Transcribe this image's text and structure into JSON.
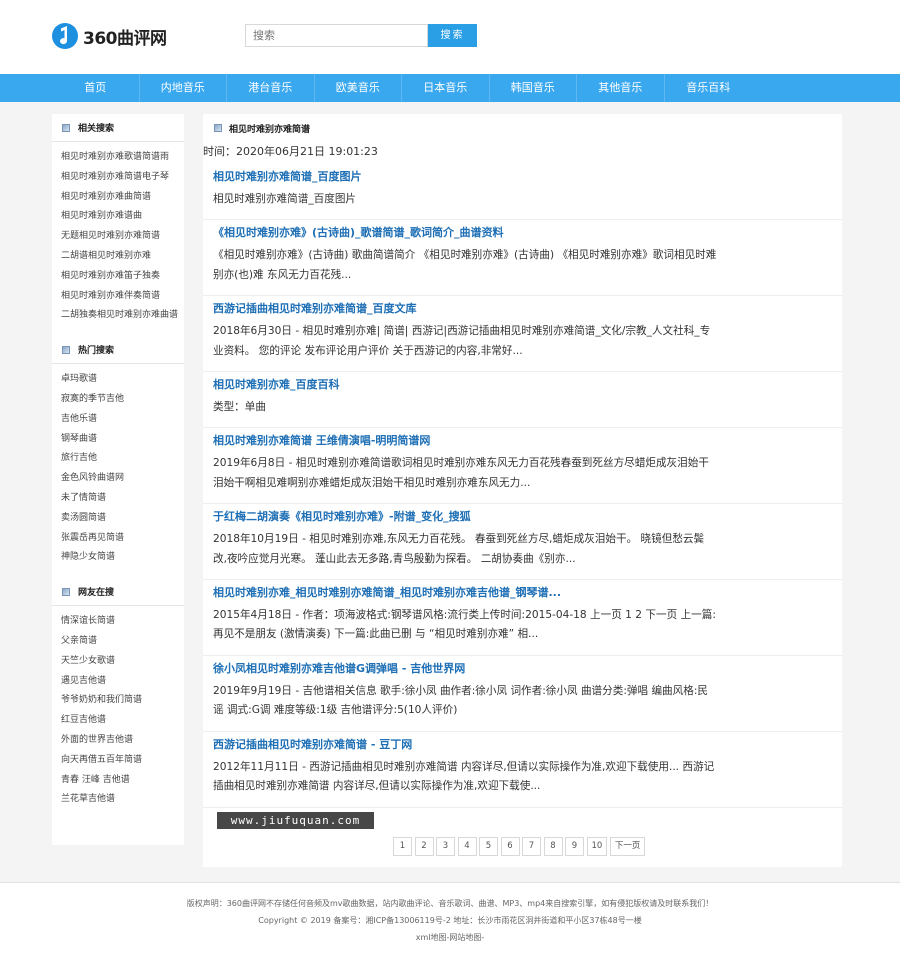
{
  "logo": {
    "text": "360曲评网"
  },
  "search": {
    "placeholder": "搜索",
    "button": "搜索"
  },
  "nav": [
    "首页",
    "内地音乐",
    "港台音乐",
    "欧美音乐",
    "日本音乐",
    "韩国音乐",
    "其他音乐",
    "音乐百科"
  ],
  "sidebar": {
    "sections": [
      {
        "title": "相关搜索",
        "items": [
          "相见时难别亦难歌谱简谱雨",
          "相见时难别亦难简谱电子琴",
          "相见时难别亦难曲简谱",
          "相见时难别亦难谱曲",
          "无题相见时难别亦难简谱",
          "二胡谱相见时难别亦难",
          "相见时难别亦难笛子独奏",
          "相见时难别亦难伴奏简谱",
          "二胡独奏相见时难别亦难曲谱"
        ]
      },
      {
        "title": "热门搜索",
        "items": [
          "卓玛歌谱",
          "寂寞的季节吉他",
          "吉他乐谱",
          "钢琴曲谱",
          "旅行吉他",
          "金色风铃曲谱网",
          "未了情简谱",
          "卖汤圆简谱",
          "张震岳再见简谱",
          "神隐少女简谱"
        ]
      },
      {
        "title": "网友在搜",
        "items": [
          "情深谊长简谱",
          "父亲简谱",
          "天竺少女歌谱",
          "遇见吉他谱",
          "爷爷奶奶和我们简谱",
          "红豆吉他谱",
          "外面的世界吉他谱",
          "向天再借五百年简谱",
          "青春 汪峰 吉他谱",
          "兰花草吉他谱"
        ]
      }
    ]
  },
  "main": {
    "title": "相见时难别亦难简谱",
    "time": "时间：2020年06月21日 19:01:23",
    "results": [
      {
        "title": "相见时难别亦难简谱_百度图片",
        "desc": "相见时难别亦难简谱_百度图片"
      },
      {
        "title": "《相见时难别亦难》(古诗曲)_歌谱简谱_歌词简介_曲谱资料",
        "desc": "《相见时难别亦难》(古诗曲) 歌曲简谱简介 《相见时难别亦难》(古诗曲) 《相见时难别亦难》歌词相见时难别亦(也)难 东风无力百花残..."
      },
      {
        "title": "西游记插曲相见时难别亦难简谱_百度文库",
        "desc": "2018年6月30日 - 相见时难别亦难| 简谱| 西游记|西游记插曲相见时难别亦难简谱_文化/宗教_人文社科_专业资料。 您的评论 发布评论用户评价 关于西游记的内容,非常好..."
      },
      {
        "title": "相见时难别亦难_百度百科",
        "desc": "类型：单曲"
      },
      {
        "title": "相见时难别亦难简谱 王维倩演唱-明明简谱网",
        "desc": "2019年6月8日 - 相见时难别亦难简谱歌词相见时难别亦难东风无力百花残春蚕到死丝方尽蜡炬成灰泪始干泪始干啊相见难啊别亦难蜡炬成灰泪始干相见时难别亦难东风无力..."
      },
      {
        "title": "于红梅二胡演奏《相见时难别亦难》-附谱_变化_搜狐",
        "desc": "2018年10月19日 - 相见时难别亦难,东风无力百花残。 春蚕到死丝方尽,蜡炬成灰泪始干。 晓镜但愁云鬓改,夜吟应觉月光寒。 蓬山此去无多路,青鸟殷勤为探看。 二胡协奏曲《别亦..."
      },
      {
        "title": "相见时难别亦难_相见时难别亦难简谱_相见时难别亦难吉他谱_钢琴谱...",
        "desc": "2015年4月18日 - 作者：项海波格式:钢琴谱风格:流行类上传时间:2015-04-18 上一页 1 2 下一页 上一篇:再见不是朋友 (激情演奏) 下一篇:此曲已删 与 “相见时难别亦难” 相..."
      },
      {
        "title": "徐小凤相见时难别亦难吉他谱G调弹唱 - 吉他世界网",
        "desc": "2019年9月19日 - 吉他谱相关信息 歌手:徐小凤 曲作者:徐小凤 词作者:徐小凤 曲谱分类:弹唱 编曲风格:民谣 调式:G调 难度等级:1级 吉他谱评分:5(10人评价)"
      },
      {
        "title": "西游记插曲相见时难别亦难简谱 - 豆丁网",
        "desc": "2012年11月11日 - 西游记插曲相见时难别亦难简谱 内容详尽,但请以实际操作为准,欢迎下载使用... 西游记插曲相见时难别亦难简谱 内容详尽,但请以实际操作为准,欢迎下载使..."
      }
    ],
    "pager": [
      "1",
      "2",
      "3",
      "4",
      "5",
      "6",
      "7",
      "8",
      "9",
      "10",
      "下一页"
    ]
  },
  "watermark": "www.jiufuquan.com",
  "footer": {
    "line1": "版权声明：360曲评网不存储任何音频及mv歌曲数据，站内歌曲评论、音乐歌词、曲谱、MP3、mp4来自搜索引擎，如有侵犯版权请及时联系我们！",
    "line2": "Copyright © 2019 备案号：湘ICP备13006119号-2 地址：长沙市雨花区洞井街道和平小区37栋48号一楼",
    "line3": "xml地图-网站地图-"
  }
}
